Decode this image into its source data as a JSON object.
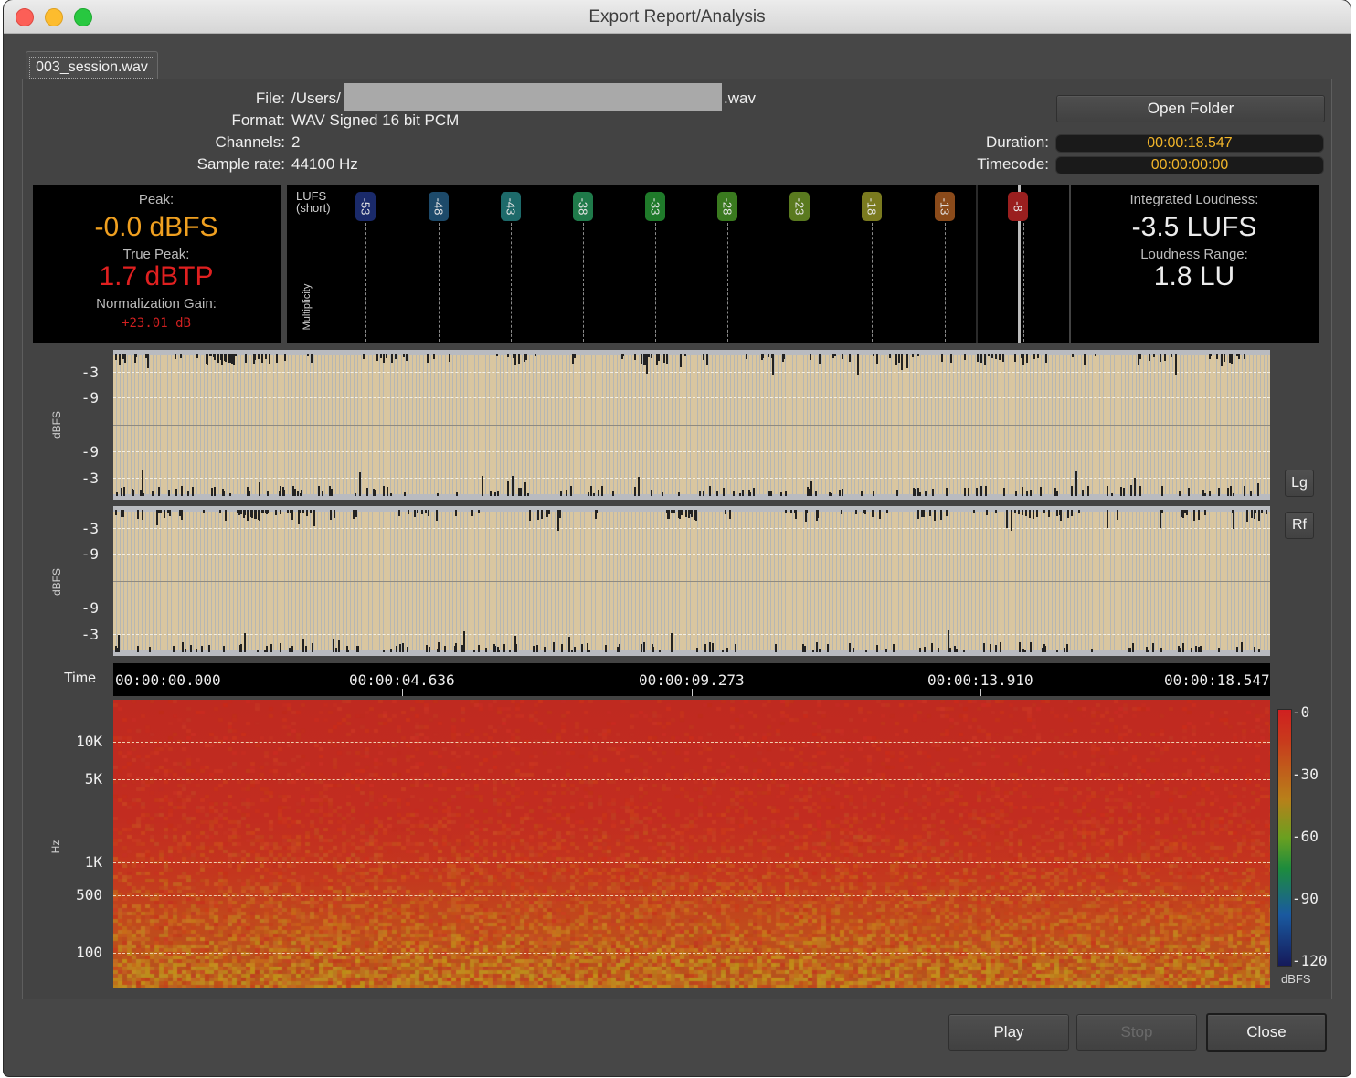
{
  "window": {
    "title": "Export Report/Analysis"
  },
  "tab": {
    "label": "003_session.wav"
  },
  "info": {
    "file_label": "File:",
    "file_value_prefix": "/Users/",
    "file_value_suffix": ".wav",
    "format_label": "Format:",
    "format_value": "WAV Signed 16 bit PCM",
    "channels_label": "Channels:",
    "channels_value": "2",
    "samplerate_label": "Sample rate:",
    "samplerate_value": "44100 Hz",
    "duration_label": "Duration:",
    "duration_value": "00:00:18.547",
    "timecode_label": "Timecode:",
    "timecode_value": "00:00:00:00"
  },
  "buttons": {
    "open_folder": "Open Folder",
    "play": "Play",
    "stop": "Stop",
    "close": "Close",
    "lg": "Lg",
    "rf": "Rf"
  },
  "peak_meter": {
    "peak_label": "Peak:",
    "peak_value": "-0.0 dBFS",
    "true_peak_label": "True Peak:",
    "true_peak_value": "1.7 dBTP",
    "norm_gain_label": "Normalization Gain:",
    "norm_gain_value": "+23.01 dB"
  },
  "lufs_meter": {
    "title_line1": "LUFS",
    "title_line2": "(short)",
    "multiplicity_label": "Multiplicity",
    "markers": [
      "-53",
      "-48",
      "-43",
      "-38",
      "-33",
      "-28",
      "-23",
      "-18",
      "-13",
      "-8"
    ],
    "marker_colors": [
      "#1a2a6a",
      "#1d4a6a",
      "#1d6a6a",
      "#1f7a4a",
      "#1f7a2a",
      "#3a7a1f",
      "#5a7a1f",
      "#7a7a1f",
      "#8a4a1a",
      "#9a1f1f"
    ]
  },
  "loudness": {
    "integrated_label": "Integrated Loudness:",
    "integrated_value": "-3.5 LUFS",
    "range_label": "Loudness Range:",
    "range_value": "1.8 LU"
  },
  "waveform": {
    "axis_label": "dBFS",
    "labels": [
      "-3",
      "-9",
      "-9",
      "-3"
    ]
  },
  "timeline": {
    "axis_label": "Time",
    "labels": [
      "00:00:00.000",
      "00:00:04.636",
      "00:00:09.273",
      "00:00:13.910",
      "00:00:18.547"
    ]
  },
  "spectrogram": {
    "axis_label": "Hz",
    "freq_labels": [
      "10K",
      "5K",
      "1K",
      "500",
      "100"
    ],
    "scale_labels": [
      "-0",
      "-30",
      "-60",
      "-90",
      "-120"
    ],
    "scale_unit": "dBFS"
  },
  "colors": {
    "peak_orange": "#f0a020",
    "true_peak_red": "#e02020",
    "value_yellow": "#f0b42a",
    "wave_fill": "#d5c09a",
    "spectro_red": "#c22c20"
  }
}
